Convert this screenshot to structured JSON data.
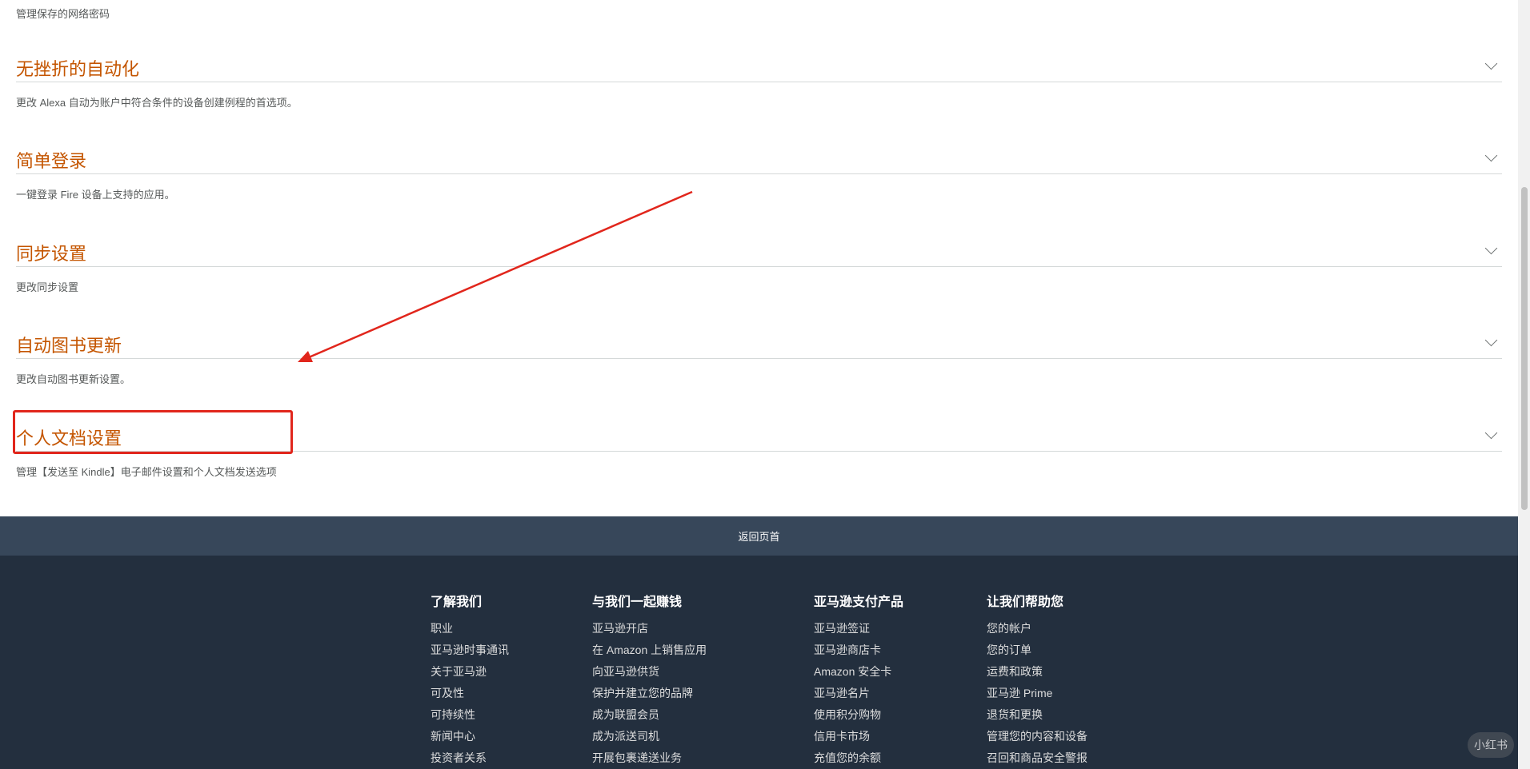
{
  "top_description": "管理保存的网络密码",
  "sections": [
    {
      "title": "无挫折的自动化",
      "description": "更改 Alexa 自动为账户中符合条件的设备创建例程的首选项。"
    },
    {
      "title": "简单登录",
      "description": "一键登录 Fire 设备上支持的应用。"
    },
    {
      "title": "同步设置",
      "description": "更改同步设置"
    },
    {
      "title": "自动图书更新",
      "description": "更改自动图书更新设置。"
    },
    {
      "title": "个人文档设置",
      "description": "管理【发送至 Kindle】电子邮件设置和个人文档发送选项"
    }
  ],
  "back_to_top": "返回页首",
  "footer": {
    "columns": [
      {
        "heading": "了解我们",
        "links": [
          "职业",
          "亚马逊时事通讯",
          "关于亚马逊",
          "可及性",
          "可持续性",
          "新闻中心",
          "投资者关系"
        ]
      },
      {
        "heading": "与我们一起赚钱",
        "links": [
          "亚马逊开店",
          "在 Amazon 上销售应用",
          "向亚马逊供货",
          "保护并建立您的品牌",
          "成为联盟会员",
          "成为派送司机",
          "开展包裹递送业务"
        ]
      },
      {
        "heading": "亚马逊支付产品",
        "links": [
          "亚马逊签证",
          "亚马逊商店卡",
          "Amazon 安全卡",
          "亚马逊名片",
          "使用积分购物",
          "信用卡市场",
          "充值您的余额"
        ]
      },
      {
        "heading": "让我们帮助您",
        "links": [
          "您的帐户",
          "您的订单",
          "运费和政策",
          "亚马逊 Prime",
          "退货和更换",
          "管理您的内容和设备",
          "召回和商品安全警报"
        ]
      }
    ]
  },
  "watermark": "小红书",
  "annotation_color": "#e1261c",
  "accent_color": "#c45500"
}
